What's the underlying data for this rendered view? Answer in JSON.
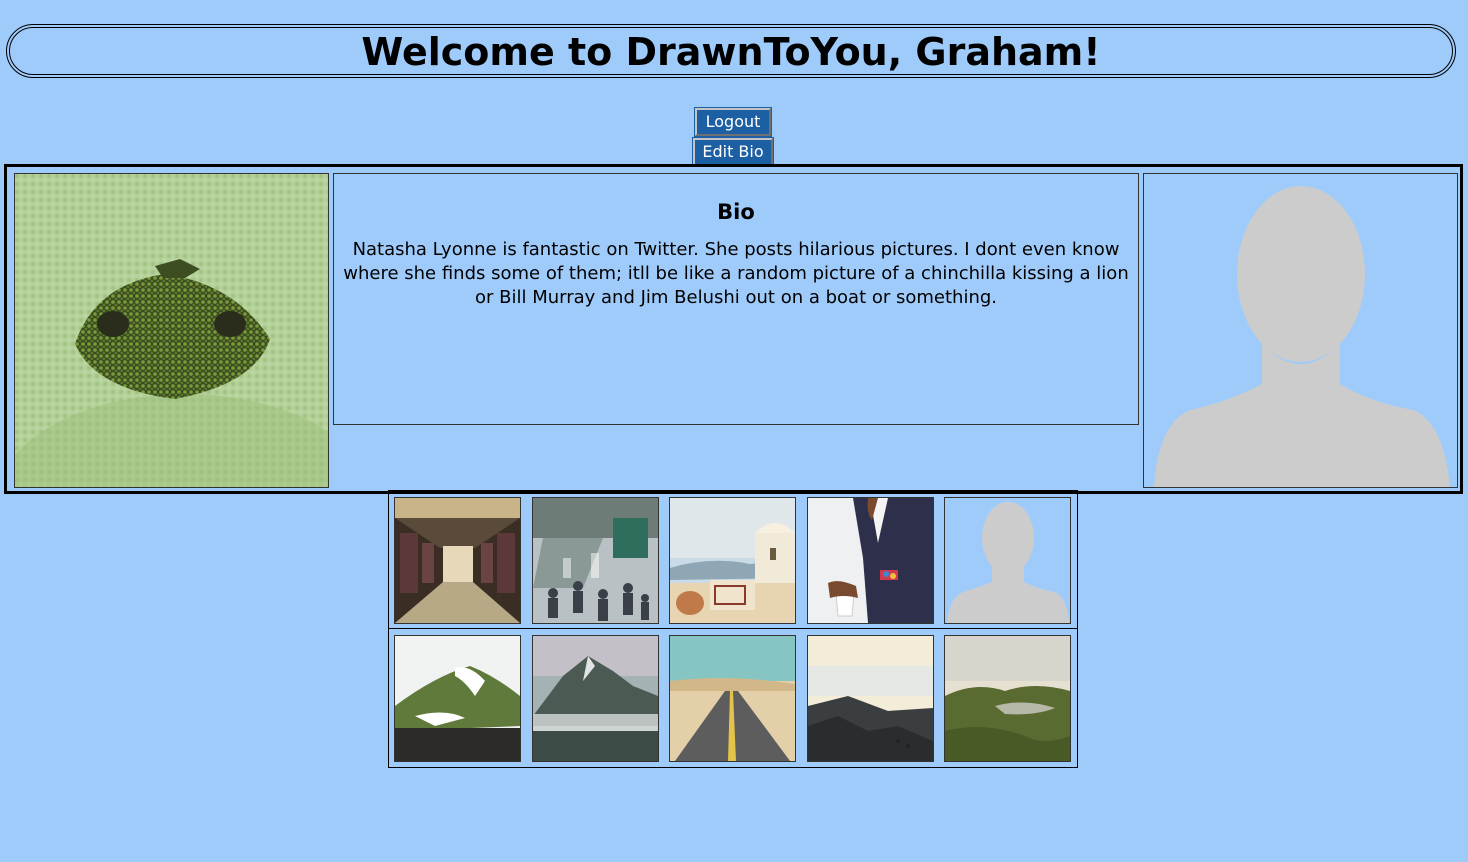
{
  "header": {
    "title": "Welcome to DrawnToYou, Graham!"
  },
  "buttons": {
    "logout_label": "Logout",
    "edit_bio_label": "Edit Bio"
  },
  "profile": {
    "photo_icon": "frog-in-duckweed-photo",
    "bio_heading": "Bio",
    "bio_text": "Natasha Lyonne is fantastic on Twitter. She posts hilarious pictures. I dont even know where she finds some of them; itll be like a random picture of a chinchilla kissing a lion or Bill Murray and Jim Belushi out on a boat or something.",
    "avatar_icon": "default-avatar-icon"
  },
  "gallery": {
    "rows": [
      [
        "train-interior-photo",
        "escalator-crowd-photo",
        "santorini-building-photo",
        "man-with-coffee-photo",
        "default-avatar-icon"
      ],
      [
        "green-hill-photo",
        "misty-mountain-photo",
        "desert-road-photo",
        "cloud-summit-photo",
        "forest-lake-photo"
      ]
    ]
  },
  "colors": {
    "background": "#9fcbfb",
    "button": "#1d5fa3",
    "avatar_silhouette": "#cccccc"
  }
}
